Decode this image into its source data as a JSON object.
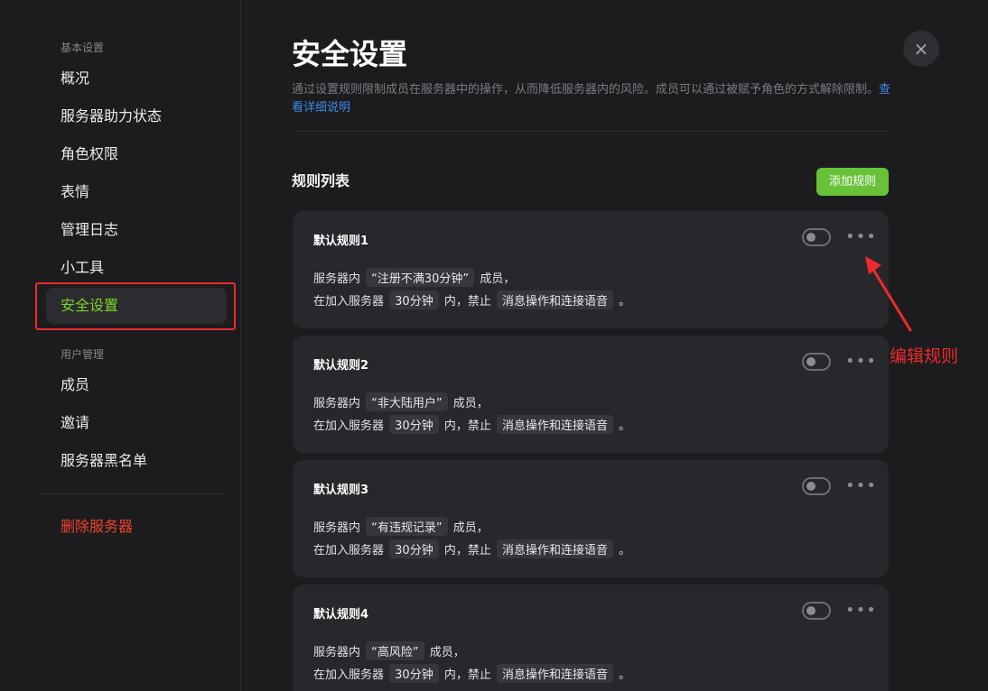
{
  "sidebar": {
    "section_basic": "基本设置",
    "basic_items": [
      "概况",
      "服务器助力状态",
      "角色权限",
      "表情",
      "管理日志",
      "小工具",
      "安全设置"
    ],
    "section_user": "用户管理",
    "user_items": [
      "成员",
      "邀请",
      "服务器黑名单"
    ],
    "delete_label": "删除服务器"
  },
  "main": {
    "title": "安全设置",
    "description": "通过设置规则限制成员在服务器中的操作，从而降低服务器内的风险。成员可以通过被赋予角色的方式解除限制。",
    "link": "查看详细说明",
    "close_icon": "×",
    "list_title": "规则列表",
    "add_rule_label": "添加规则",
    "rule_texts": {
      "prefix": "服务器内",
      "member_suffix": "成员，",
      "join_prefix": "在加入服务器",
      "within": "内，禁止",
      "end": "。"
    },
    "rules": [
      {
        "name": "默认规则1",
        "condition": "“注册不满30分钟”",
        "duration": "30分钟",
        "forbid": "消息操作和连接语音",
        "enabled": false
      },
      {
        "name": "默认规则2",
        "condition": "“非大陆用户”",
        "duration": "30分钟",
        "forbid": "消息操作和连接语音",
        "enabled": false
      },
      {
        "name": "默认规则3",
        "condition": "“有违规记录”",
        "duration": "30分钟",
        "forbid": "消息操作和连接语音",
        "enabled": false
      },
      {
        "name": "默认规则4",
        "condition": "“高风险”",
        "duration": "30分钟",
        "forbid": "消息操作和连接语音",
        "enabled": false
      }
    ]
  },
  "annotation": {
    "label": "编辑规则",
    "color": "#ec2b2b"
  },
  "colors": {
    "accent": "#7ed321",
    "add_button": "#67c23a",
    "danger": "#f2412b",
    "link": "#3d8ae6"
  }
}
